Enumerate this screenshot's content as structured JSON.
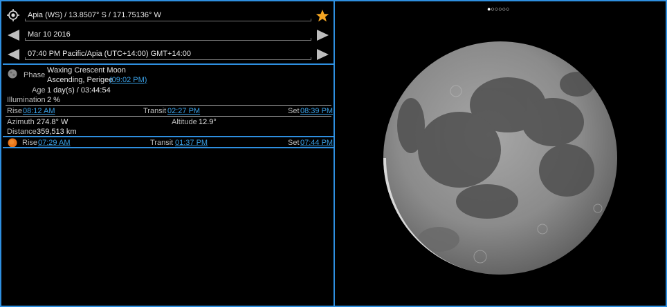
{
  "location": {
    "text": "Apia (WS)  /  13.8507° S  /  171.75136° W"
  },
  "date": {
    "text": "Mar 10 2016"
  },
  "time": {
    "text": "07:40 PM Pacific/Apia (UTC+14:00) GMT+14:00"
  },
  "moon": {
    "phase_label": "Phase",
    "phase_value": "Waxing Crescent Moon",
    "phase_line2": "Ascending, Perigee",
    "phase_time": "(09:02 PM)",
    "age_label": "Age",
    "age_value": "1 day(s) / 03:44:54",
    "illumination_label": "Illumination",
    "illumination_value": "2 %",
    "rise_label": "Rise",
    "rise_time": "08:12 AM",
    "transit_label": "Transit",
    "transit_time": "02:27 PM",
    "set_label": "Set",
    "set_time": "08:39 PM",
    "azimuth_label": "Azimuth",
    "azimuth_value": "274.8° W",
    "altitude_label": "Altitude",
    "altitude_value": "12.9°",
    "distance_label": "Distance",
    "distance_value": "359,513 km"
  },
  "sun": {
    "rise_label": "Rise",
    "rise_time": "07:29 AM",
    "transit_label": "Transit",
    "transit_time": "01:37 PM",
    "set_label": "Set",
    "set_time": "07:44 PM"
  },
  "pager": {
    "indicator": "●○○○○○"
  },
  "colors": {
    "accent": "#2e8fe0",
    "link": "#3aa0e6",
    "star": "#f5a623",
    "sun": "#e8751a"
  }
}
